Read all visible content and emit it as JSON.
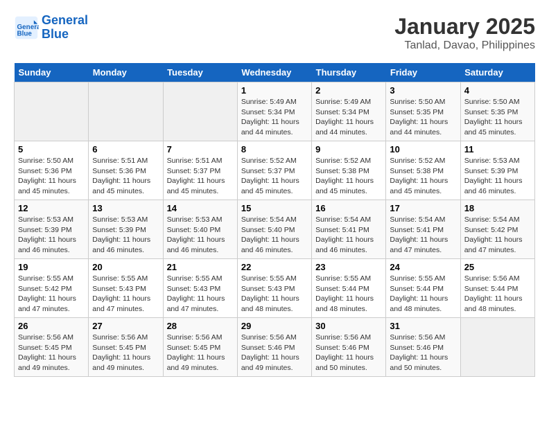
{
  "header": {
    "logo_line1": "General",
    "logo_line2": "Blue",
    "title": "January 2025",
    "subtitle": "Tanlad, Davao, Philippines"
  },
  "days_of_week": [
    "Sunday",
    "Monday",
    "Tuesday",
    "Wednesday",
    "Thursday",
    "Friday",
    "Saturday"
  ],
  "weeks": [
    [
      {
        "num": "",
        "info": ""
      },
      {
        "num": "",
        "info": ""
      },
      {
        "num": "",
        "info": ""
      },
      {
        "num": "1",
        "info": "Sunrise: 5:49 AM\nSunset: 5:34 PM\nDaylight: 11 hours and 44 minutes."
      },
      {
        "num": "2",
        "info": "Sunrise: 5:49 AM\nSunset: 5:34 PM\nDaylight: 11 hours and 44 minutes."
      },
      {
        "num": "3",
        "info": "Sunrise: 5:50 AM\nSunset: 5:35 PM\nDaylight: 11 hours and 44 minutes."
      },
      {
        "num": "4",
        "info": "Sunrise: 5:50 AM\nSunset: 5:35 PM\nDaylight: 11 hours and 45 minutes."
      }
    ],
    [
      {
        "num": "5",
        "info": "Sunrise: 5:50 AM\nSunset: 5:36 PM\nDaylight: 11 hours and 45 minutes."
      },
      {
        "num": "6",
        "info": "Sunrise: 5:51 AM\nSunset: 5:36 PM\nDaylight: 11 hours and 45 minutes."
      },
      {
        "num": "7",
        "info": "Sunrise: 5:51 AM\nSunset: 5:37 PM\nDaylight: 11 hours and 45 minutes."
      },
      {
        "num": "8",
        "info": "Sunrise: 5:52 AM\nSunset: 5:37 PM\nDaylight: 11 hours and 45 minutes."
      },
      {
        "num": "9",
        "info": "Sunrise: 5:52 AM\nSunset: 5:38 PM\nDaylight: 11 hours and 45 minutes."
      },
      {
        "num": "10",
        "info": "Sunrise: 5:52 AM\nSunset: 5:38 PM\nDaylight: 11 hours and 45 minutes."
      },
      {
        "num": "11",
        "info": "Sunrise: 5:53 AM\nSunset: 5:39 PM\nDaylight: 11 hours and 46 minutes."
      }
    ],
    [
      {
        "num": "12",
        "info": "Sunrise: 5:53 AM\nSunset: 5:39 PM\nDaylight: 11 hours and 46 minutes."
      },
      {
        "num": "13",
        "info": "Sunrise: 5:53 AM\nSunset: 5:39 PM\nDaylight: 11 hours and 46 minutes."
      },
      {
        "num": "14",
        "info": "Sunrise: 5:53 AM\nSunset: 5:40 PM\nDaylight: 11 hours and 46 minutes."
      },
      {
        "num": "15",
        "info": "Sunrise: 5:54 AM\nSunset: 5:40 PM\nDaylight: 11 hours and 46 minutes."
      },
      {
        "num": "16",
        "info": "Sunrise: 5:54 AM\nSunset: 5:41 PM\nDaylight: 11 hours and 46 minutes."
      },
      {
        "num": "17",
        "info": "Sunrise: 5:54 AM\nSunset: 5:41 PM\nDaylight: 11 hours and 47 minutes."
      },
      {
        "num": "18",
        "info": "Sunrise: 5:54 AM\nSunset: 5:42 PM\nDaylight: 11 hours and 47 minutes."
      }
    ],
    [
      {
        "num": "19",
        "info": "Sunrise: 5:55 AM\nSunset: 5:42 PM\nDaylight: 11 hours and 47 minutes."
      },
      {
        "num": "20",
        "info": "Sunrise: 5:55 AM\nSunset: 5:43 PM\nDaylight: 11 hours and 47 minutes."
      },
      {
        "num": "21",
        "info": "Sunrise: 5:55 AM\nSunset: 5:43 PM\nDaylight: 11 hours and 47 minutes."
      },
      {
        "num": "22",
        "info": "Sunrise: 5:55 AM\nSunset: 5:43 PM\nDaylight: 11 hours and 48 minutes."
      },
      {
        "num": "23",
        "info": "Sunrise: 5:55 AM\nSunset: 5:44 PM\nDaylight: 11 hours and 48 minutes."
      },
      {
        "num": "24",
        "info": "Sunrise: 5:55 AM\nSunset: 5:44 PM\nDaylight: 11 hours and 48 minutes."
      },
      {
        "num": "25",
        "info": "Sunrise: 5:56 AM\nSunset: 5:44 PM\nDaylight: 11 hours and 48 minutes."
      }
    ],
    [
      {
        "num": "26",
        "info": "Sunrise: 5:56 AM\nSunset: 5:45 PM\nDaylight: 11 hours and 49 minutes."
      },
      {
        "num": "27",
        "info": "Sunrise: 5:56 AM\nSunset: 5:45 PM\nDaylight: 11 hours and 49 minutes."
      },
      {
        "num": "28",
        "info": "Sunrise: 5:56 AM\nSunset: 5:45 PM\nDaylight: 11 hours and 49 minutes."
      },
      {
        "num": "29",
        "info": "Sunrise: 5:56 AM\nSunset: 5:46 PM\nDaylight: 11 hours and 49 minutes."
      },
      {
        "num": "30",
        "info": "Sunrise: 5:56 AM\nSunset: 5:46 PM\nDaylight: 11 hours and 50 minutes."
      },
      {
        "num": "31",
        "info": "Sunrise: 5:56 AM\nSunset: 5:46 PM\nDaylight: 11 hours and 50 minutes."
      },
      {
        "num": "",
        "info": ""
      }
    ]
  ]
}
